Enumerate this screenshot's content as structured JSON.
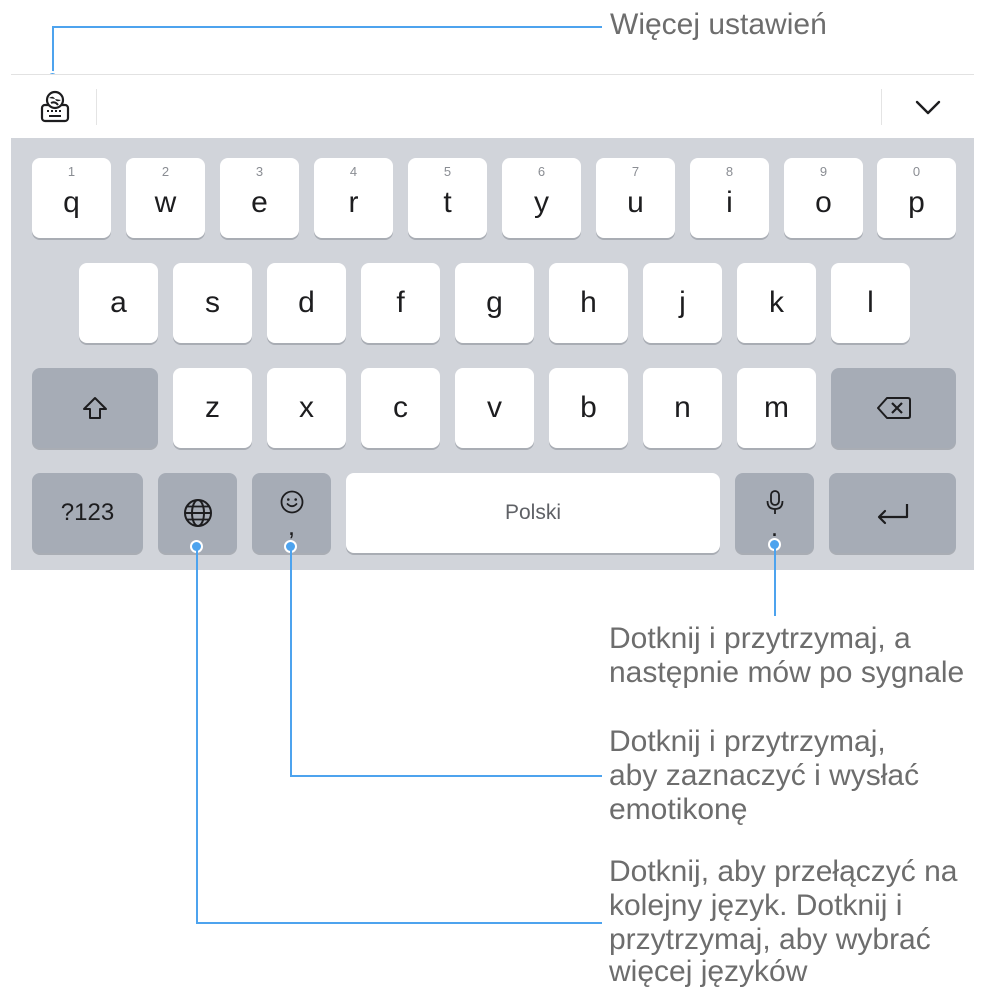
{
  "toolbar": {
    "settings_icon": "keyboard-globe-settings-icon",
    "collapse_icon": "chevron-down-icon"
  },
  "keyboard": {
    "row1": [
      {
        "main": "q",
        "hint": "1"
      },
      {
        "main": "w",
        "hint": "2"
      },
      {
        "main": "e",
        "hint": "3"
      },
      {
        "main": "r",
        "hint": "4"
      },
      {
        "main": "t",
        "hint": "5"
      },
      {
        "main": "y",
        "hint": "6"
      },
      {
        "main": "u",
        "hint": "7"
      },
      {
        "main": "i",
        "hint": "8"
      },
      {
        "main": "o",
        "hint": "9"
      },
      {
        "main": "p",
        "hint": "0"
      }
    ],
    "row2": [
      "a",
      "s",
      "d",
      "f",
      "g",
      "h",
      "j",
      "k",
      "l"
    ],
    "row3": [
      "z",
      "x",
      "c",
      "v",
      "b",
      "n",
      "m"
    ],
    "shift_icon": "shift-arrow-icon",
    "backspace_icon": "backspace-icon",
    "num_label": "?123",
    "globe_icon": "globe-icon",
    "emoji_icon": "smiley-icon",
    "comma": ",",
    "space_label": "Polski",
    "mic_icon": "microphone-icon",
    "period": ".",
    "enter_icon": "enter-arrow-icon"
  },
  "callouts": {
    "settings": "Więcej ustawień",
    "voice": [
      "Dotknij i przytrzymaj, a",
      "następnie mów po sygnale"
    ],
    "emoji": [
      "Dotknij i przytrzymaj,",
      "aby zaznaczyć i wysłać",
      "emotikonę"
    ],
    "language": [
      "Dotknij, aby przełączyć na",
      "kolejny język. Dotknij i",
      "przytrzymaj, aby wybrać",
      "więcej języków"
    ]
  },
  "colors": {
    "callout": "#4da3ee",
    "keyboard_bg": "#d1d4da",
    "function_key": "#a6acb6"
  }
}
